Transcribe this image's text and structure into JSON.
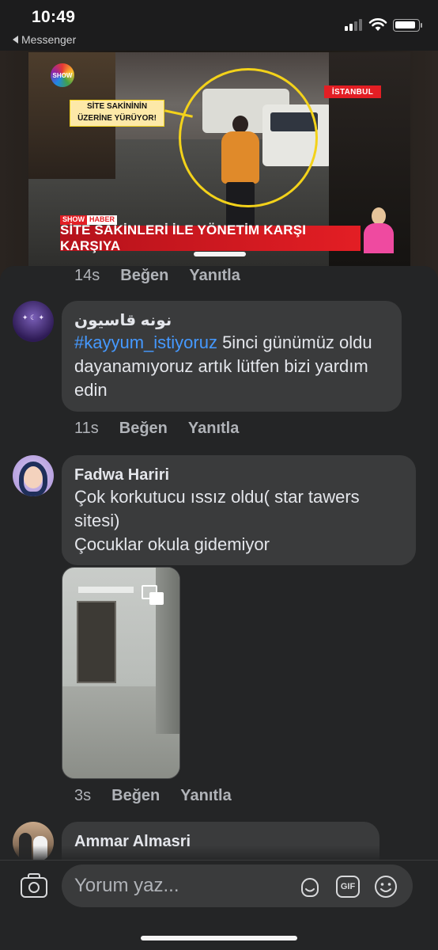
{
  "status_bar": {
    "time": "10:49",
    "back_app": "Messenger",
    "battery_level": 0.92
  },
  "video": {
    "channel_logo": "SHOW",
    "city_tag": "İSTANBUL",
    "callout": "SİTE SAKİNİNİN ÜZERİNE YÜRÜYOR!",
    "tag_show": "SHOW",
    "tag_haber": "HABER",
    "headline": "SİTE SAKİNLERİ İLE YÖNETİM KARŞI KARŞIYA"
  },
  "top_actions": {
    "time": "14s",
    "like": "Beğen",
    "reply": "Yanıtla"
  },
  "comments": [
    {
      "author": "نونه قاسيون",
      "hashtag": "#kayyum_istiyoruz",
      "text": " 5inci günümüz oldu dayanamıyoruz artık lütfen bizi yardım edin",
      "time": "11s",
      "like": "Beğen",
      "reply": "Yanıtla"
    },
    {
      "author": "Fadwa Hariri",
      "line1": "Çok korkutucu ıssız oldu( star tawers sitesi)",
      "line2": "Çocuklar okula gidemiyor",
      "time": "3s",
      "like": "Beğen",
      "reply": "Yanıtla"
    },
    {
      "author": "Ammar Almasri"
    }
  ],
  "composer": {
    "placeholder": "Yorum yaz...",
    "gif_label": "GIF"
  },
  "icons": [
    "camera-icon",
    "sticker-icon",
    "gif-icon",
    "emoji-icon",
    "picture-in-picture-icon",
    "wifi-icon",
    "battery-icon",
    "cellular-signal-icon",
    "back-arrow-icon"
  ]
}
